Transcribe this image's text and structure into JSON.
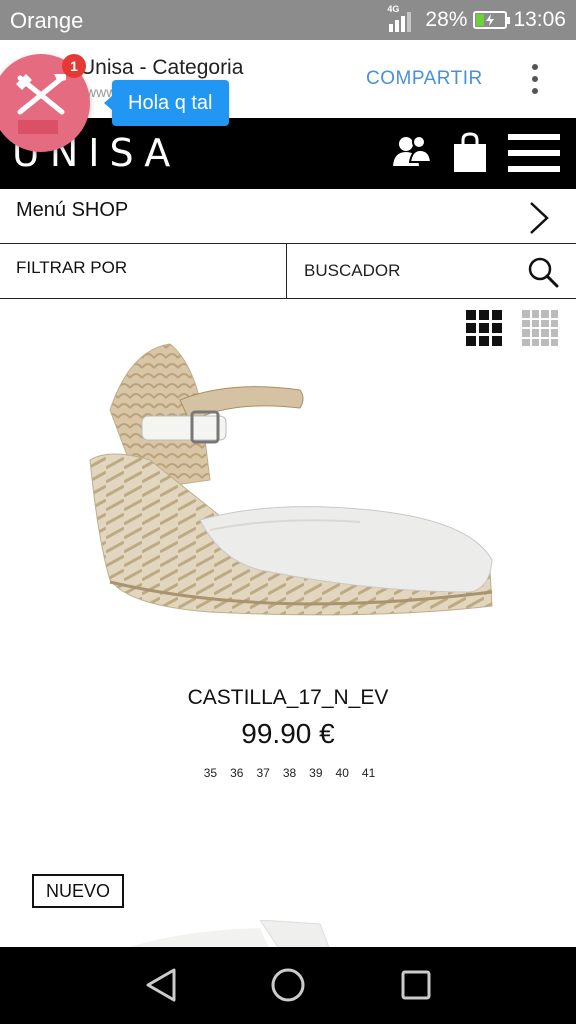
{
  "status_bar": {
    "carrier": "Orange",
    "network": "4G",
    "battery_percent": "28%",
    "battery_level": 0.28,
    "time": "13:06",
    "colors": {
      "background": "#8c8c8c",
      "battery_fill": "#6fd13a"
    }
  },
  "app_bar": {
    "title": "Unisa - Categoria",
    "url": "www",
    "share_label": "COMPARTIR",
    "more_icon": "vertical-dots-icon",
    "colors": {
      "share": "#4a90d9"
    }
  },
  "chat_head": {
    "icon": "tools-icon",
    "badge_count": "1",
    "message": "Hola q tal",
    "colors": {
      "head": "#e56b80",
      "bubble": "#2196f3",
      "badge": "#e53935"
    }
  },
  "site_header": {
    "logo": "UNISA",
    "icons": [
      "users-icon",
      "shopping-bag-icon",
      "hamburger-menu-icon"
    ]
  },
  "menu": {
    "label": "Menú SHOP",
    "icon": "chevron-right-icon"
  },
  "filters": {
    "filter_label": "FILTRAR POR",
    "search_label": "BUSCADOR",
    "search_icon": "search-icon"
  },
  "view_toggles": [
    "grid-3-icon",
    "grid-4-icon"
  ],
  "product": {
    "name": "CASTILLA_17_N_EV",
    "price": "99.90 €",
    "sizes": [
      "35",
      "36",
      "37",
      "38",
      "39",
      "40",
      "41"
    ]
  },
  "next_product": {
    "badge": "NUEVO"
  },
  "nav_bar": {
    "icons": [
      "back-icon",
      "home-icon",
      "recents-icon"
    ]
  }
}
